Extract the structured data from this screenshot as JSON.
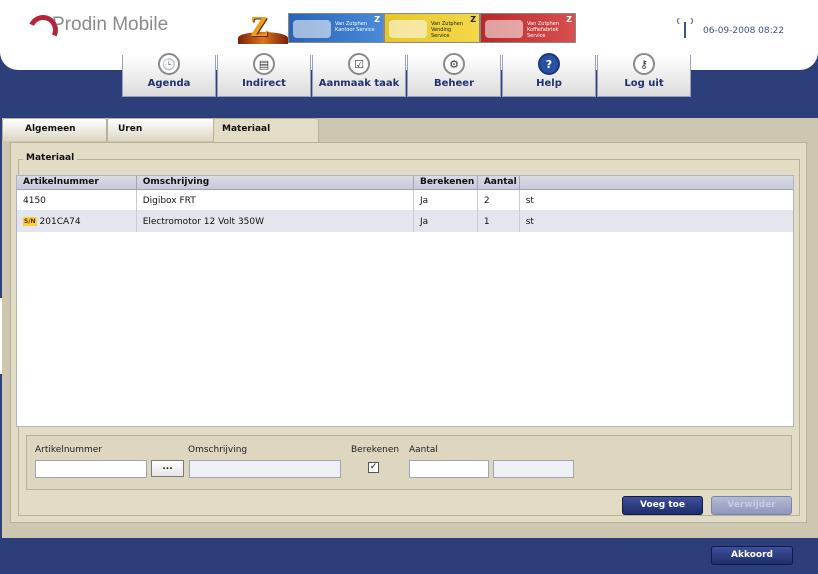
{
  "app": {
    "logo_text": "Prodin Mobile",
    "datetime": "06-09-2008 08:22",
    "banner": [
      {
        "line1": "Van Zutphen",
        "line2": "Kantoor Service"
      },
      {
        "line1": "Van Zutphen",
        "line2": "Vending Service"
      },
      {
        "line1": "Van Zutphen",
        "line2": "Koffiefabriek Service"
      }
    ],
    "banner_mark": "Z"
  },
  "nav": {
    "items": [
      {
        "label": "Agenda",
        "icon": "clock-icon",
        "glyph": "🕒"
      },
      {
        "label": "Indirect",
        "icon": "document-icon",
        "glyph": "▤"
      },
      {
        "label": "Aanmaak taak",
        "icon": "checklist-icon",
        "glyph": "☑"
      },
      {
        "label": "Beheer",
        "icon": "gear-icon",
        "glyph": "⚙"
      },
      {
        "label": "Help",
        "icon": "help-icon",
        "glyph": "?"
      },
      {
        "label": "Log uit",
        "icon": "key-icon",
        "glyph": "⚷"
      }
    ]
  },
  "tabs": [
    {
      "label": "Algemeen"
    },
    {
      "label": "Uren"
    },
    {
      "label": "Materiaal"
    }
  ],
  "active_tab": "Materiaal",
  "group_title": "Materiaal",
  "table": {
    "columns": [
      "Artikelnummer",
      "Omschrijving",
      "Berekenen",
      "Aantal",
      ""
    ],
    "rows": [
      {
        "serial_badge": "",
        "artikelnummer": "4150",
        "omschrijving": "Digibox FRT",
        "berekenen": "Ja",
        "aantal": "2",
        "eenheid": "st"
      },
      {
        "serial_badge": "S/N",
        "artikelnummer": "201CA74",
        "omschrijving": "Electromotor 12 Volt 350W",
        "berekenen": "Ja",
        "aantal": "1",
        "eenheid": "st"
      }
    ]
  },
  "form": {
    "artikelnummer_label": "Artikelnummer",
    "omschrijving_label": "Omschrijving",
    "berekenen_label": "Berekenen",
    "aantal_label": "Aantal",
    "browse_label": "...",
    "berekenen_checked": "✓",
    "artikelnummer_value": "",
    "omschrijving_value": "",
    "aantal_value": "",
    "eenheid_value": ""
  },
  "buttons": {
    "add": "Voeg toe",
    "remove": "Verwijder",
    "ok": "Akkoord"
  },
  "colors": {
    "navy": "#2c3f7a",
    "panel": "#cdc6b1",
    "accent_red": "#b5243a"
  }
}
